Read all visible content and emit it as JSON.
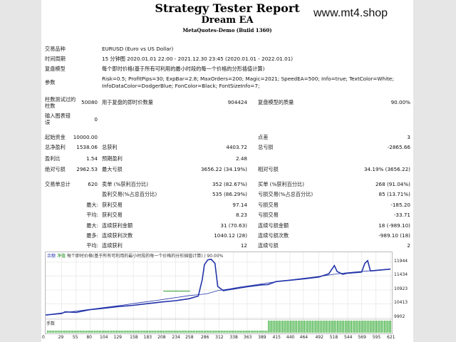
{
  "header": {
    "title": "Strategy Tester Report",
    "ea_name": "Dream EA",
    "build": "MetaQuotes-Demo (Build 1360)",
    "watermark": "www.mt4.shop"
  },
  "settings": {
    "symbol_label": "交易品种",
    "symbol_value": "EURUSD (Euro vs US Dollar)",
    "period_label": "时间周期",
    "period_value": "15 分钟图 2020.01.01 22:00 - 2021.12.30 23:45 (2020.01.01 - 2022.01.01)",
    "model_label": "复盘模型",
    "model_value": "每个即时价格(基于所有可利用的最小时段的每一个价格的分形插值计算)",
    "params_label": "参数",
    "params_line1": "Risk=0.5; ProfitPips=30; ExpBar=2.8; MaxOrders=200; Magic=2021; SpeedEA=500; Info=true; TextColor=White;",
    "params_line2": "InfoDataColor=DodgerBlue; FonColor=Black; FontSizeInfo=7;"
  },
  "bars_section": {
    "bars_label_1": "柱数测试过的",
    "bars_label_2": "柱数",
    "bars_value": "50080",
    "ticks_label": "用于复盘的即时价数量",
    "ticks_value": "904424",
    "quality_label": "复盘模型的质量",
    "quality_value": "90.00%",
    "errors_label_1": "输入图表错",
    "errors_label_2": "误",
    "errors_value": "0"
  },
  "stats": {
    "deposit_label": "起始资金",
    "deposit_value": "10000.00",
    "spread_label": "点差",
    "spread_value": "3",
    "netprofit_label": "总净盈利",
    "netprofit_value": "1538.06",
    "grossprofit_label": "总获利",
    "grossprofit_value": "4403.72",
    "grossloss_label": "总亏损",
    "grossloss_value": "-2865.66",
    "pf_label": "盈利比",
    "pf_value": "1.54",
    "ep_label": "预期盈利",
    "ep_value": "2.48",
    "absdd_label": "绝对亏损",
    "absdd_value": "2962.53",
    "maxdd_label": "最大亏损",
    "maxdd_value": "3656.22 (34.19%)",
    "reldd_label": "相对亏损",
    "reldd_value": "34.19% (3656.22)",
    "trades_label": "交易单总计",
    "trades_value": "620",
    "short_label": "卖单 (%获利百分比)",
    "short_value": "352 (82.67%)",
    "long_label": "买单 (%获利百分比)",
    "long_value": "268 (91.04%)",
    "profit_trades_label": "盈利交易(%占总百分比)",
    "profit_trades_value": "535 (86.29%)",
    "loss_trades_label": "亏损交易(%占总百分比)",
    "loss_trades_value": "85 (13.71%)",
    "max_l": "最大:",
    "avg_l": "平均:",
    "maximal_l": "最多:",
    "avg2_l": "平均:",
    "largest_profit_label": "获利交易",
    "largest_profit_value": "97.14",
    "largest_loss_label": "亏损交易",
    "largest_loss_value": "-185.20",
    "avg_profit_label": "获利交易",
    "avg_profit_value": "8.23",
    "avg_loss_label": "亏损交易",
    "avg_loss_value": "-33.71",
    "max_cons_wins_label": "连续获利金额",
    "max_cons_wins_value": "31 (70.63)",
    "max_cons_losses_label": "连续亏损金额",
    "max_cons_losses_value": "18 (-989.10)",
    "max_cons_profit_label": "连续获利次数",
    "max_cons_profit_value": "1040.12 (28)",
    "max_cons_loss_label": "连续亏损次数",
    "max_cons_loss_value": "-989.10 (18)",
    "avg_cons_wins_label": "连续获利",
    "avg_cons_wins_value": "12",
    "avg_cons_losses_label": "连续亏损",
    "avg_cons_losses_value": "2"
  },
  "chart_legend": {
    "balance": "余额",
    "equity": "净值",
    "text": "每个即时价格(基于所有可利用的最小时段的每一个价格的分形插值计算) / 90.00%",
    "deposit_load": "手数"
  },
  "chart_data": {
    "type": "line",
    "title": "",
    "ylim": [
      9902,
      12100
    ],
    "y_ticks": [
      "11944",
      "11434",
      "10923",
      "10413",
      "9902"
    ],
    "x_ticks": [
      "0",
      "29",
      "55",
      "80",
      "104",
      "129",
      "158",
      "183",
      "208",
      "234",
      "258",
      "286",
      "312",
      "338",
      "363",
      "389",
      "415",
      "440",
      "464",
      "492",
      "518",
      "544",
      "569",
      "595",
      "621"
    ],
    "xlim": [
      0,
      621
    ],
    "series": [
      {
        "name": "余额",
        "color": "#2233aa",
        "x": [
          0,
          20,
          40,
          60,
          80,
          100,
          120,
          140,
          160,
          180,
          200,
          220,
          240,
          260,
          275,
          290,
          310,
          330,
          350,
          370,
          380,
          400,
          420,
          440,
          460,
          480,
          500,
          520,
          540,
          560,
          580,
          600,
          621
        ],
        "y": [
          10005,
          10060,
          10110,
          10160,
          10210,
          10265,
          10315,
          10370,
          10430,
          10485,
          10540,
          10600,
          10660,
          10720,
          10750,
          10780,
          10900,
          10960,
          11030,
          11090,
          11120,
          11180,
          11240,
          11290,
          11340,
          11390,
          11440,
          11500,
          11550,
          11590,
          11620,
          11660,
          11690
        ]
      },
      {
        "name": "净值",
        "color": "#2233aa",
        "x": [
          0,
          29,
          35,
          55,
          80,
          104,
          129,
          158,
          183,
          208,
          234,
          258,
          275,
          282,
          286,
          292,
          298,
          305,
          310,
          320,
          338,
          363,
          389,
          400,
          415,
          440,
          464,
          492,
          510,
          520,
          525,
          535,
          544,
          569,
          575,
          580,
          585,
          595,
          621
        ],
        "y": [
          10005,
          10060,
          10120,
          10100,
          10200,
          10250,
          10310,
          10360,
          10420,
          10480,
          10530,
          10600,
          10700,
          11300,
          11850,
          12030,
          12050,
          11900,
          11050,
          10900,
          10960,
          11040,
          11110,
          11120,
          11230,
          11280,
          11330,
          11400,
          11520,
          11820,
          11600,
          11500,
          11540,
          11580,
          11900,
          12000,
          11620,
          11640,
          11690
        ]
      }
    ],
    "deposit_load_start_x": 398
  }
}
